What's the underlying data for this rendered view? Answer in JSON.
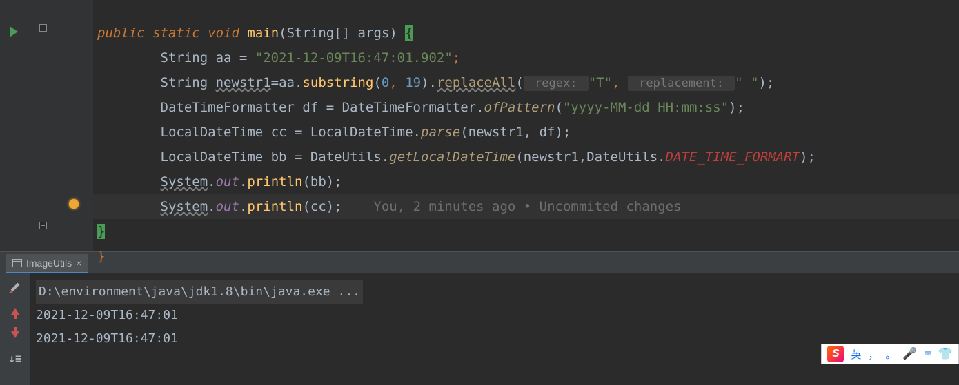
{
  "code": {
    "line1_kw1": "public",
    "line1_kw2": "static",
    "line1_kw3": "void",
    "line1_method": "main",
    "line1_params": "(String[] args) ",
    "line1_brace": "{",
    "line2": "        String aa = ",
    "line2_str": "\"2021-12-09T16:47:01.902\"",
    "line2_end": ";",
    "line3_pre": "        String ",
    "line3_var": "newstr1",
    "line3_mid": "=aa.",
    "line3_m1": "substring",
    "line3_args1": "(",
    "line3_n1": "0",
    "line3_c": ", ",
    "line3_n2": "19",
    "line3_close1": ").",
    "line3_m2": "replaceAll",
    "line3_open2": "(",
    "line3_hint1": " regex: ",
    "line3_str1": "\"T\"",
    "line3_comma2": ", ",
    "line3_hint2": " replacement: ",
    "line3_str2": "\" \"",
    "line3_end": ");",
    "line4_pre": "        DateTimeFormatter df = DateTimeFormatter.",
    "line4_m": "ofPattern",
    "line4_open": "(",
    "line4_str": "\"yyyy-MM-dd HH:mm:ss\"",
    "line4_end": ");",
    "line5_pre": "        LocalDateTime cc = LocalDateTime.",
    "line5_m": "parse",
    "line5_args": "(newstr1, df);",
    "line6_pre": "        LocalDateTime bb = DateUtils.",
    "line6_m": "getLocalDateTime",
    "line6_args1": "(newstr1,DateUtils.",
    "line6_const": "DATE_TIME_FORMART",
    "line6_end": ");",
    "line7_pre": "        ",
    "line7_sys": "System",
    "line7_dot1": ".",
    "line7_out": "out",
    "line7_dot2": ".",
    "line7_m": "println",
    "line7_args": "(bb);",
    "line8_pre": "        ",
    "line8_sys": "System",
    "line8_dot1": ".",
    "line8_out": "out",
    "line8_dot2": ".",
    "line8_m": "println",
    "line8_args": "(cc);",
    "line8_annotation": "    You, 2 minutes ago • Uncommited changes",
    "line9_brace": "}",
    "line10_brace": "}"
  },
  "tab": {
    "name": "ImageUtils",
    "close": "×"
  },
  "console": {
    "cmd": "D:\\environment\\java\\jdk1.8\\bin\\java.exe ...",
    "out1": "2021-12-09T16:47:01",
    "out2": "2021-12-09T16:47:01"
  },
  "ime": {
    "logo": "S",
    "lang": "英",
    "comma": "，",
    "dot": "。"
  }
}
